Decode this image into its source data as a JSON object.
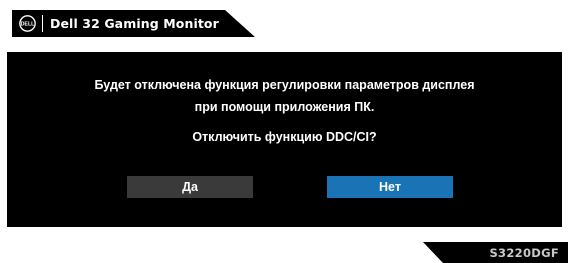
{
  "header": {
    "logo_icon": "dell-logo-icon",
    "logo_text": "DELL",
    "title": "Dell 32 Gaming Monitor"
  },
  "dialog": {
    "message_line1": "Будет отключена функция регулировки параметров дисплея",
    "message_line2": "при помощи приложения ПК.",
    "question": "Отключить функцию DDC/CI?",
    "yes_label": "Да",
    "no_label": "Нет",
    "selected": "no"
  },
  "footer": {
    "model": "S3220DGF"
  },
  "colors": {
    "background": "#ffffff",
    "panel": "#000000",
    "button_unselected": "#3a3a3a",
    "button_selected": "#1a73b5",
    "text": "#ffffff",
    "model_text": "#c8c8c8"
  }
}
